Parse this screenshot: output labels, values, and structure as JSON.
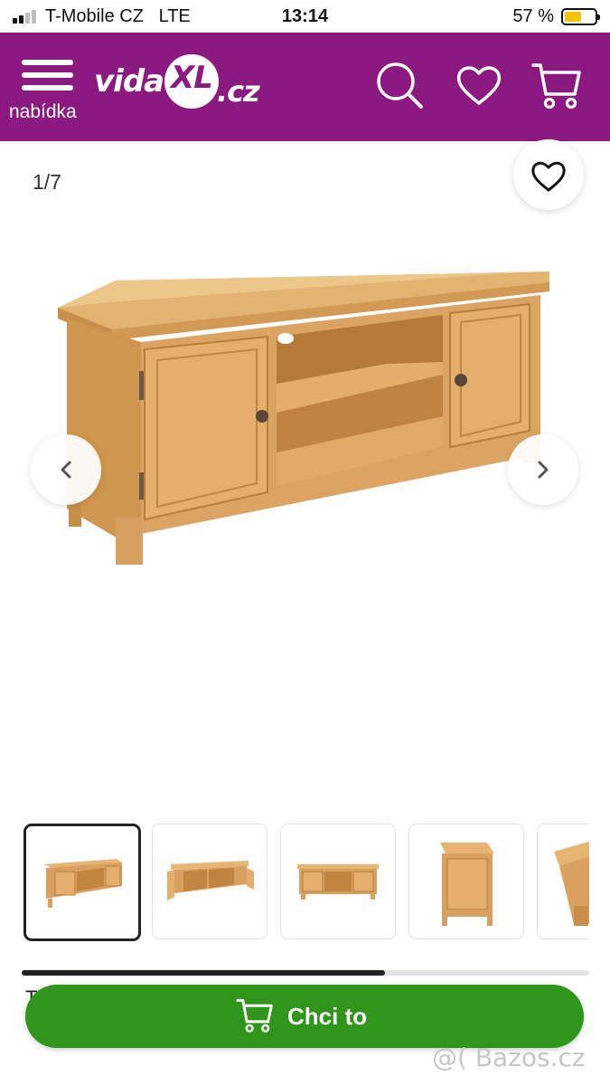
{
  "status_bar": {
    "carrier": "T-Mobile CZ",
    "network": "LTE",
    "time": "13:14",
    "battery_percent": "57 %",
    "battery_level": 0.57,
    "battery_color": "#f5c400"
  },
  "header": {
    "background_color": "#8b1a80",
    "menu_label": "nabídka",
    "logo_prefix": "vida",
    "logo_mark": "XL",
    "logo_suffix": ".cz",
    "icons": [
      "search-icon",
      "heart-icon",
      "cart-icon"
    ]
  },
  "gallery": {
    "counter": "1/7",
    "current_index": 1,
    "total_images": 7,
    "thumbnail_scroll_progress": 0.64,
    "icons": [
      "heart-icon",
      "chevron-left-icon",
      "chevron-right-icon"
    ]
  },
  "cta": {
    "label": "Chci to",
    "color": "#2f961b",
    "icon": "cart-icon"
  },
  "partial_text": "T",
  "watermark": "@( Bazos.cz"
}
